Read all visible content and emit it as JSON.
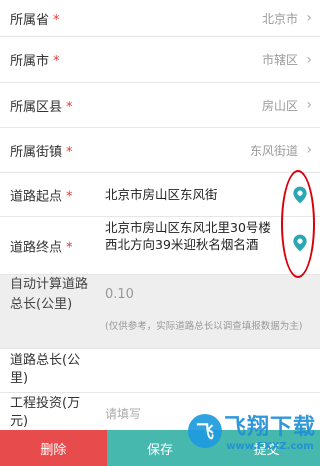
{
  "form": {
    "province": {
      "label": "所属省",
      "required": "*",
      "value": "北京市"
    },
    "city": {
      "label": "所属市",
      "required": "*",
      "value": "市辖区"
    },
    "district": {
      "label": "所属区县",
      "required": "*",
      "value": "房山区"
    },
    "street": {
      "label": "所属街镇",
      "required": "*",
      "value": "东风街道"
    },
    "start": {
      "label": "道路起点",
      "required": "*",
      "value": "北京市房山区东风街"
    },
    "end": {
      "label": "道路终点",
      "required": "*",
      "value": "北京市房山区东风北里30号楼西北方向39米迎秋名烟名酒"
    },
    "auto_length": {
      "label": "自动计算道路总长(公里)",
      "value": "0.10",
      "note": "(仅供参考，实际道路总长以调查填报数据为主)"
    },
    "road_length": {
      "label": "道路总长(公里)"
    },
    "investment": {
      "label": "工程投资(万元)",
      "placeholder": "请填写"
    }
  },
  "actions": {
    "delete": "删除",
    "save": "保存",
    "submit": "提交"
  },
  "watermark": {
    "logo": "飞",
    "text": "飞翔下载",
    "url": "www.FXXZ.com"
  },
  "icons": {
    "chevron": "chevron-right-icon",
    "pin": "location-pin-icon"
  },
  "colors": {
    "required": "#e53935",
    "delete": "#e84b4b",
    "accent": "#46b8ae",
    "pin": "#2aa7b3",
    "annotation": "#d9000d"
  }
}
